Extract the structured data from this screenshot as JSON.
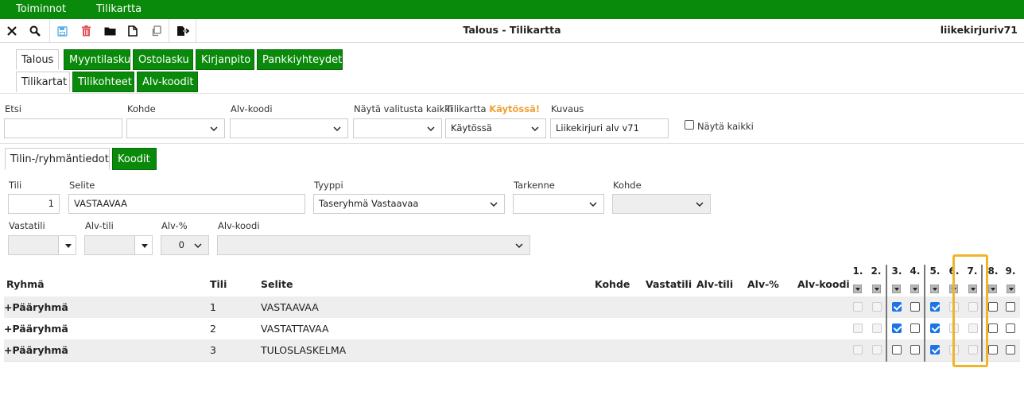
{
  "menubar": {
    "items": [
      "Toiminnot",
      "Tilikartta"
    ]
  },
  "toolbar": {
    "title": "Talous - Tilikartta",
    "user": "liikekirjuriv71"
  },
  "tabs_main": [
    "Talous",
    "Myyntilasku",
    "Ostolasku",
    "Kirjanpito",
    "Pankkiyhteydet"
  ],
  "tabs_sub": [
    "Tilikartat",
    "Tilikohteet",
    "Alv-koodit"
  ],
  "filters": {
    "etsi_label": "Etsi",
    "etsi_value": "",
    "kohde_label": "Kohde",
    "kohde_value": "",
    "alvkoodi_label": "Alv-koodi",
    "alvkoodi_value": "",
    "nayta_label": "Näytä valitusta kaikki",
    "nayta_value": "",
    "tilikartta_label": "Tilikartta",
    "tilikartta_status": "Käytössä!",
    "tilikartta_value": "Käytössä",
    "kuvaus_label": "Kuvaus",
    "kuvaus_value": "Liikekirjuri alv v71",
    "naytakaikki_label": "Näytä kaikki"
  },
  "tabs_detail": [
    "Tilin-/ryhmäntiedot",
    "Koodit"
  ],
  "detail": {
    "tili_label": "Tili",
    "tili_value": "1",
    "selite_label": "Selite",
    "selite_value": "VASTAAVAA",
    "tyyppi_label": "Tyyppi",
    "tyyppi_value": "Taseryhmä Vastaavaa",
    "tarkenne_label": "Tarkenne",
    "tarkenne_value": "",
    "kohde_label": "Kohde",
    "kohde_value": "",
    "vastatili_label": "Vastatili",
    "alvtili_label": "Alv-tili",
    "alvpros_label": "Alv-%",
    "alvpros_value": "0",
    "alvkoodi_label": "Alv-koodi"
  },
  "table": {
    "headers": [
      "Ryhmä",
      "Tili",
      "Selite",
      "Kohde",
      "Vastatili",
      "Alv-tili",
      "Alv-%",
      "Alv-koodi"
    ],
    "col_numbers": [
      "1.",
      "2.",
      "3.",
      "4.",
      "5.",
      "6.",
      "7.",
      "8.",
      "9."
    ],
    "rows": [
      {
        "ryhma": "+Pääryhmä",
        "tili": "1",
        "selite": "VASTAAVAA",
        "checks": [
          "dim",
          "dim",
          "on",
          "off",
          "on",
          "dim",
          "dim",
          "off",
          "off"
        ]
      },
      {
        "ryhma": "+Pääryhmä",
        "tili": "2",
        "selite": "VASTATTAVAA",
        "checks": [
          "dim",
          "dim",
          "on",
          "off",
          "on",
          "dim",
          "dim",
          "off",
          "off"
        ]
      },
      {
        "ryhma": "+Pääryhmä",
        "tili": "3",
        "selite": "TULOSLASKELMA",
        "checks": [
          "dim",
          "dim",
          "off",
          "off",
          "on",
          "dim",
          "dim",
          "off",
          "off"
        ]
      }
    ]
  },
  "colors": {
    "brand_green": "#0a8a0a",
    "status_orange": "#f0a030",
    "highlight": "#f0b429",
    "check_blue": "#1a73e8"
  },
  "icons": [
    "close-icon",
    "search-icon",
    "save-icon",
    "delete-icon",
    "folder-icon",
    "new-document-icon",
    "copy-icon",
    "export-icon"
  ]
}
